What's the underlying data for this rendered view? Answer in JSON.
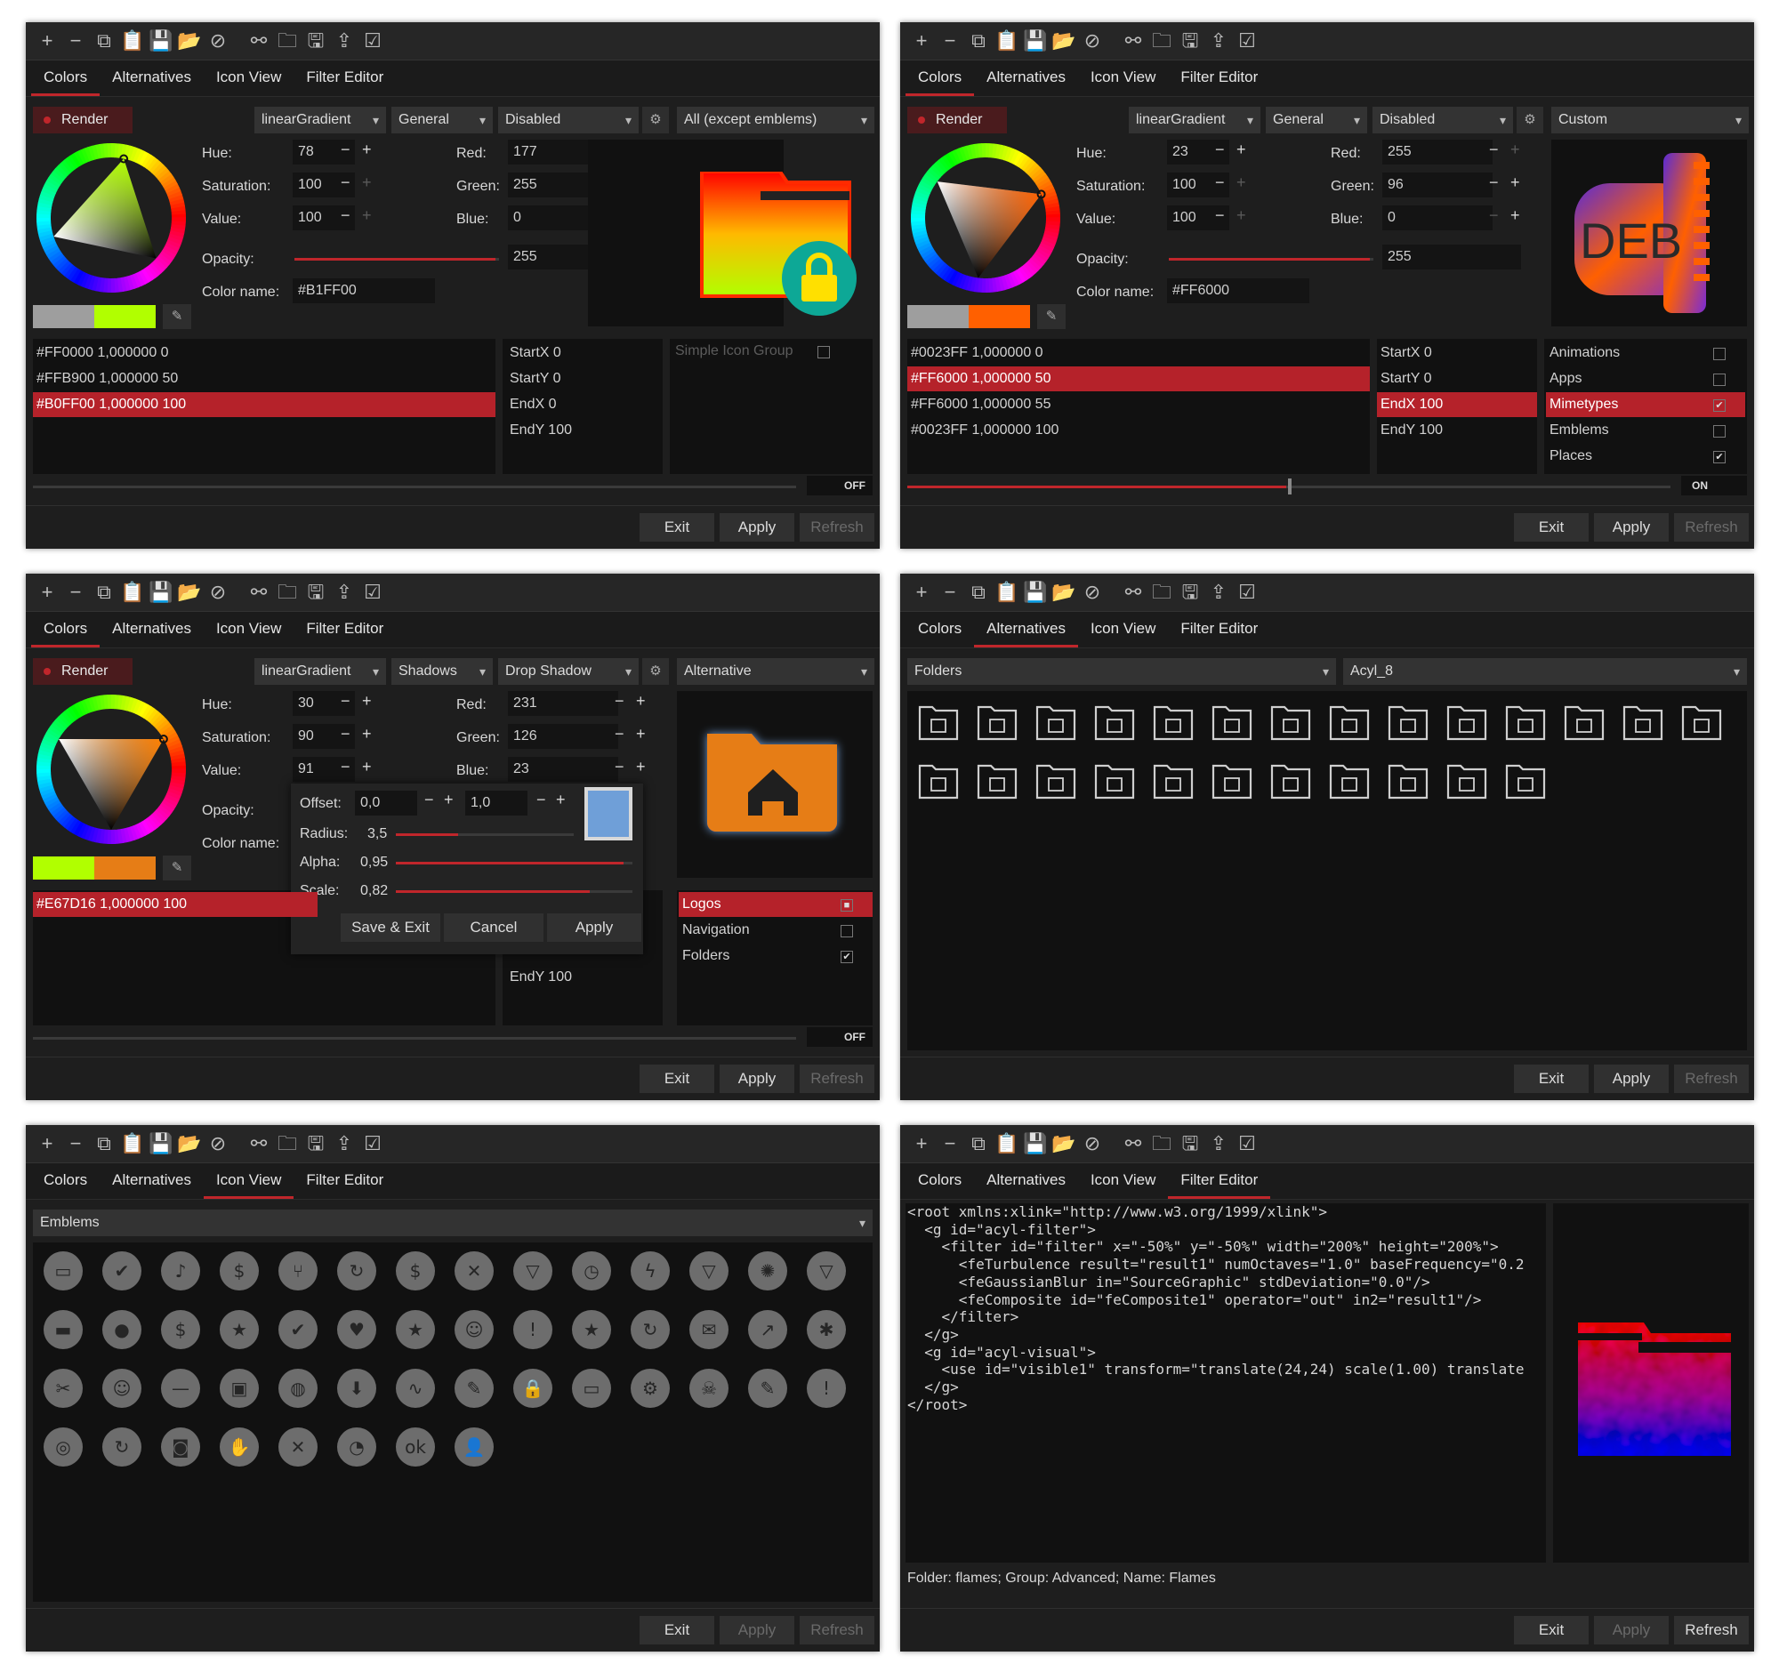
{
  "toolbar": {
    "icons": [
      "plus-icon",
      "minus-icon",
      "copy-icon",
      "paste-icon",
      "save-icon",
      "open-folder-icon",
      "clear-icon",
      "link-icon",
      "folder-icon",
      "save-as-icon",
      "export-icon",
      "apply-icon"
    ]
  },
  "tabs": [
    "Colors",
    "Alternatives",
    "Icon View",
    "Filter Editor"
  ],
  "buttons": {
    "exit": "Exit",
    "apply": "Apply",
    "refresh": "Refresh",
    "save_exit": "Save & Exit",
    "cancel": "Cancel"
  },
  "labels": {
    "render": "Render",
    "hue": "Hue:",
    "saturation": "Saturation:",
    "value": "Value:",
    "red": "Red:",
    "green": "Green:",
    "blue": "Blue:",
    "opacity": "Opacity:",
    "color_name": "Color name:",
    "offset": "Offset:",
    "radius": "Radius:",
    "alpha": "Alpha:",
    "scale": "Scale:",
    "off": "OFF",
    "on": "ON"
  },
  "w1": {
    "combos": [
      "linearGradient",
      "General",
      "Disabled",
      "All (except emblems)"
    ],
    "hue": "78",
    "saturation": "100",
    "value": "100",
    "red": "177",
    "green": "255",
    "blue": "0",
    "opacity": "255",
    "color_name": "#B1FF00",
    "swatch_colors": [
      "#9e9e9e",
      "#b1ff00"
    ],
    "stops": [
      "#FF0000  1,000000  0",
      "#FFB900  1,000000  50",
      "#B0FF00  1,000000  100"
    ],
    "coords": [
      "StartX  0",
      "StartY  0",
      "EndX    0",
      "EndY    100"
    ],
    "group": "Simple Icon Group"
  },
  "w2": {
    "combos": [
      "linearGradient",
      "General",
      "Disabled",
      "Custom"
    ],
    "hue": "23",
    "saturation": "100",
    "value": "100",
    "red": "255",
    "green": "96",
    "blue": "0",
    "opacity": "255",
    "color_name": "#FF6000",
    "swatch_colors": [
      "#9e9e9e",
      "#ff6000"
    ],
    "stops": [
      "#0023FF  1,000000  0",
      "#FF6000  1,000000  50",
      "#FF6000  1,000000  55",
      "#0023FF  1,000000  100"
    ],
    "coords": [
      "StartX  0",
      "StartY  0",
      "EndX    100",
      "EndY    100"
    ],
    "categories": [
      {
        "name": "Animations",
        "checked": ""
      },
      {
        "name": "Apps",
        "checked": ""
      },
      {
        "name": "Mimetypes",
        "checked": "✔"
      },
      {
        "name": "Emblems",
        "checked": ""
      },
      {
        "name": "Places",
        "checked": "✔"
      }
    ],
    "preview_text": "DEB"
  },
  "w3": {
    "combos": [
      "linearGradient",
      "Shadows",
      "Drop Shadow",
      "Alternative"
    ],
    "hue": "30",
    "saturation": "90",
    "value": "91",
    "red": "231",
    "green": "126",
    "blue": "23",
    "swatch_colors": [
      "#b1ff00",
      "#e67d16"
    ],
    "stops": [
      "#E67D16  1,000000  100"
    ],
    "endy": "EndY    100",
    "offset_x": "0,0",
    "offset_y": "1,0",
    "radius": "3,5",
    "alpha": "0,95",
    "scale": "0,82",
    "shadow_color": "#6f9fd8",
    "categories": [
      {
        "name": "Logos",
        "checked": "■"
      },
      {
        "name": "Navigation",
        "checked": ""
      },
      {
        "name": "Folders",
        "checked": "✔"
      }
    ]
  },
  "w4": {
    "combos": [
      "Folders",
      "Acyl_8"
    ],
    "icons": [
      "folder-home-icon",
      "folder-camera-icon",
      "folder-tools-icon",
      "folder-document-icon",
      "folder-grid-icon",
      "folder-add-icon",
      "folder-music-icon",
      "folder-plain-icon",
      "folder-cloud-icon",
      "folder-warning-icon",
      "folder-globe-icon",
      "folder-shield-icon",
      "folder-server-icon",
      "folder-desktop-icon",
      "folder-download-icon",
      "folder-star-icon",
      "folder-open-icon",
      "folder-search-icon",
      "folder-lock-icon",
      "folder-settings-icon",
      "folder-empty-icon",
      "folder-monitor-icon",
      "folder-gear-icon",
      "folder-new-icon",
      "folder-open-alt-icon"
    ]
  },
  "w5": {
    "combos": [
      "Emblems"
    ],
    "icons": [
      "emblem-phone-icon",
      "emblem-check-shield-icon",
      "emblem-music-icon",
      "emblem-money-icon",
      "emblem-share-icon",
      "emblem-sync-icon",
      "emblem-dollar-icon",
      "emblem-close-icon",
      "emblem-down-icon",
      "emblem-clock-icon",
      "emblem-flash-icon",
      "emblem-filter-icon",
      "emblem-badge-icon",
      "emblem-triangle-icon",
      "emblem-film-icon",
      "emblem-user-icon",
      "emblem-tax-icon",
      "emblem-star-down-icon",
      "emblem-ok-icon",
      "emblem-heart-icon",
      "emblem-star-icon",
      "emblem-smile-icon",
      "emblem-alert-icon",
      "emblem-favorite-icon",
      "emblem-refresh-icon",
      "emblem-mail-icon",
      "emblem-trend-icon",
      "emblem-asterisk-icon",
      "emblem-tools-icon",
      "emblem-cool-icon",
      "emblem-minus-icon",
      "emblem-photo-icon",
      "emblem-globe-icon",
      "emblem-download-icon",
      "emblem-graph-icon",
      "emblem-note-icon",
      "emblem-lock-icon",
      "emblem-folder-icon",
      "emblem-gear-icon",
      "emblem-skull-icon",
      "emblem-pen-icon",
      "emblem-exclaim-icon",
      "emblem-reel-icon",
      "emblem-update-icon",
      "emblem-camera-icon",
      "emblem-handshake-icon",
      "emblem-vee-icon",
      "emblem-pie-icon",
      "emblem-ok-text-icon",
      "emblem-people-icon"
    ]
  },
  "w6": {
    "code": "<root xmlns:xlink=\"http://www.w3.org/1999/xlink\">\n  <g id=\"acyl-filter\">\n    <filter id=\"filter\" x=\"-50%\" y=\"-50%\" width=\"200%\" height=\"200%\">\n      <feTurbulence result=\"result1\" numOctaves=\"1.0\" baseFrequency=\"0.2\n      <feGaussianBlur in=\"SourceGraphic\" stdDeviation=\"0.0\"/>\n      <feComposite id=\"feComposite1\" operator=\"out\" in2=\"result1\"/>\n    </filter>\n  </g>\n  <g id=\"acyl-visual\">\n    <use id=\"visible1\" transform=\"translate(24,24) scale(1.00) translate\n  </g>\n</root>",
    "status": "Folder: flames; Group: Advanced; Name: Flames"
  }
}
